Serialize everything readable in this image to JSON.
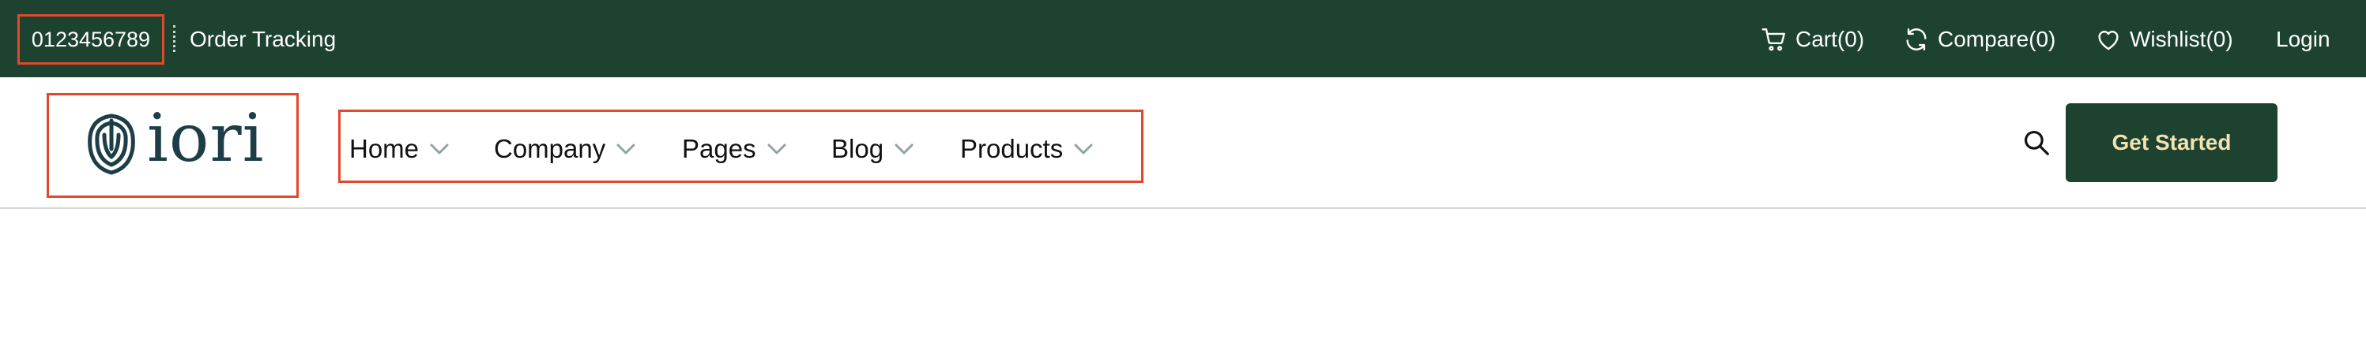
{
  "topbar": {
    "phone": "0123456789",
    "order_tracking": "Order Tracking",
    "cart": "Cart(0)",
    "compare": "Compare(0)",
    "wishlist": "Wishlist(0)",
    "login": "Login"
  },
  "header": {
    "logo_text": "iori",
    "nav": {
      "home": "Home",
      "company": "Company",
      "pages": "Pages",
      "blog": "Blog",
      "products": "Products"
    },
    "cta": "Get Started"
  },
  "colors": {
    "topbar_bg": "#1d4230",
    "highlight_border": "#e2482a",
    "cta_text": "#f3e3b1",
    "logo": "#1e3e47",
    "chevron": "#8fa3a6"
  },
  "icons": [
    "cart-icon",
    "compare-icon",
    "heart-icon",
    "chevron-down-icon",
    "search-icon",
    "fingerprint-logo-icon"
  ]
}
